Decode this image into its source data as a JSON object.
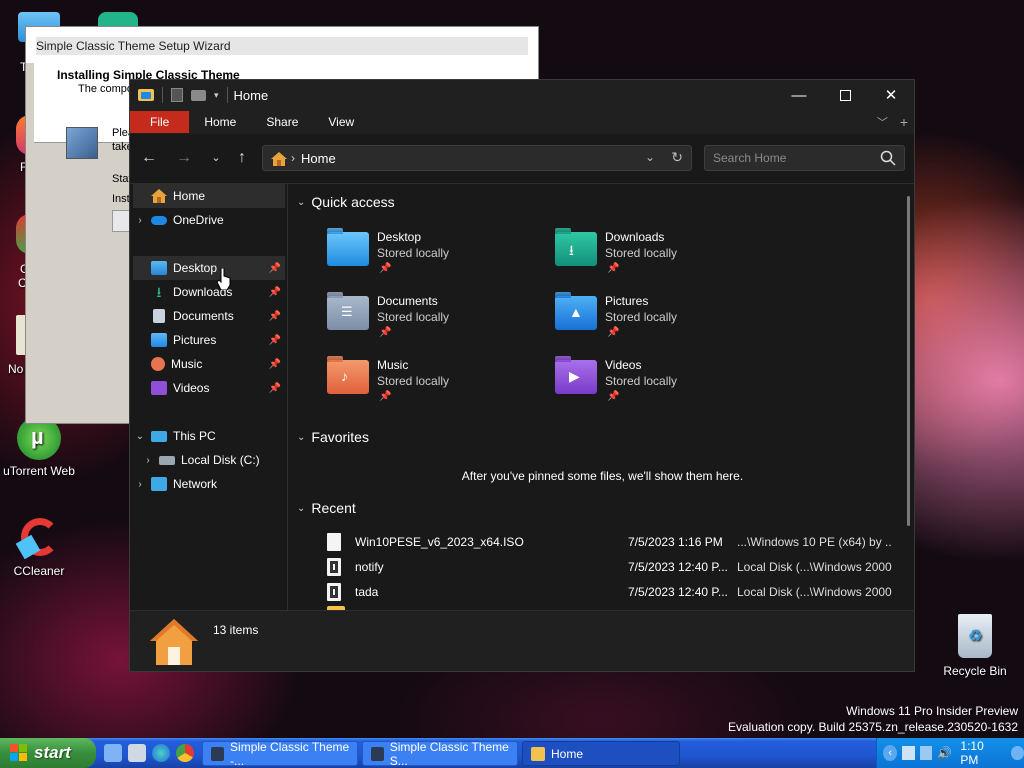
{
  "desktop": {
    "icons": [
      {
        "label": "uTorrent Web"
      },
      {
        "label": "CCleaner"
      }
    ],
    "partial_labels": [
      "T",
      "F",
      "G",
      "C",
      "No"
    ],
    "recycle_bin": "Recycle Bin",
    "watermark": {
      "line1": "Windows 11 Pro Insider Preview",
      "line2": "Evaluation copy. Build 25375.zn_release.230520-1632"
    }
  },
  "wizard": {
    "title": "Simple Classic Theme Setup Wizard",
    "header": "Installing Simple Classic Theme",
    "subheader": "The compo",
    "text1": "Plea",
    "text2": "take",
    "text3": "Stat",
    "text4": "Inst"
  },
  "explorer": {
    "title": "Home",
    "ribbon_tabs": [
      "File",
      "Home",
      "Share",
      "View"
    ],
    "address": {
      "path": "Home"
    },
    "search": {
      "placeholder": "Search Home"
    },
    "nav": [
      {
        "label": "Home"
      },
      {
        "label": "OneDrive"
      },
      {
        "label": "Desktop"
      },
      {
        "label": "Downloads"
      },
      {
        "label": "Documents"
      },
      {
        "label": "Pictures"
      },
      {
        "label": "Music"
      },
      {
        "label": "Videos"
      },
      {
        "label": "This PC"
      },
      {
        "label": "Local Disk (C:)"
      },
      {
        "label": "Network"
      }
    ],
    "sections": {
      "quick_access": "Quick access",
      "favorites": "Favorites",
      "recent": "Recent"
    },
    "quick_access": [
      {
        "name": "Desktop",
        "status": "Stored locally",
        "color": "#2ea3f2"
      },
      {
        "name": "Downloads",
        "status": "Stored locally",
        "color": "#1ba88f"
      },
      {
        "name": "Documents",
        "status": "Stored locally",
        "color": "#8fa3bb"
      },
      {
        "name": "Pictures",
        "status": "Stored locally",
        "color": "#1e88e5"
      },
      {
        "name": "Music",
        "status": "Stored locally",
        "color": "#e8744f"
      },
      {
        "name": "Videos",
        "status": "Stored locally",
        "color": "#8f4fd8"
      }
    ],
    "favorites_message": "After you've pinned some files, we'll show them here.",
    "recent": [
      {
        "name": "Win10PESE_v6_2023_x64.ISO",
        "date": "7/5/2023 1:16 PM",
        "location": "...\\Windows 10 PE (x64) by ..."
      },
      {
        "name": "notify",
        "date": "7/5/2023 12:40 P...",
        "location": "Local Disk (...\\Windows 2000"
      },
      {
        "name": "tada",
        "date": "7/5/2023 12:40 P...",
        "location": "Local Disk (...\\Windows 2000"
      }
    ],
    "details": {
      "count": "13 items"
    }
  },
  "taskbar": {
    "start": "start",
    "buttons": [
      {
        "label": "Simple Classic Theme -..."
      },
      {
        "label": "Simple Classic Theme S..."
      },
      {
        "label": "Home"
      }
    ],
    "clock": "1:10 PM"
  }
}
